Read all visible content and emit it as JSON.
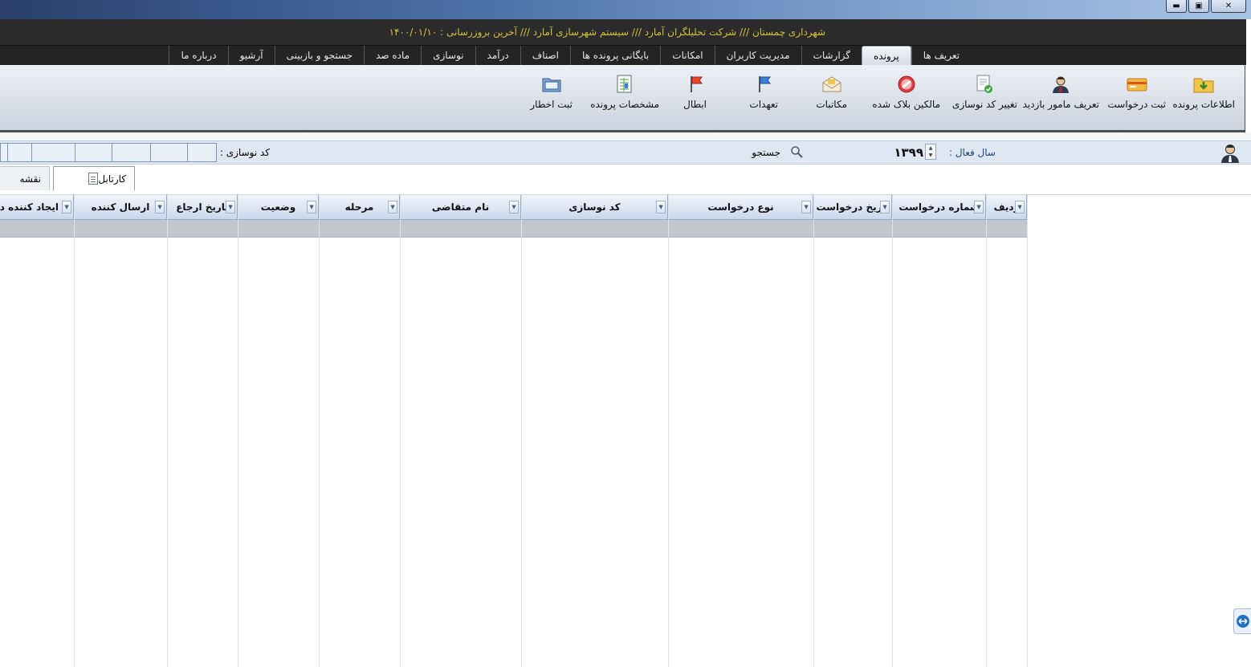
{
  "window": {
    "minimize_glyph": "▬",
    "maximize_glyph": "▣",
    "close_glyph": "✕"
  },
  "info_bar": {
    "text": "شهرداری چمستان  ///  شرکت تحلیلگران آمارد  ///  سیستم شهرسازی آمارد  ///  آخرین بروزرسانی : ۱۴۰۰/۰۱/۱۰"
  },
  "menu_tabs": [
    {
      "label": "تعریف ها",
      "active": false
    },
    {
      "label": "پرونده",
      "active": true
    },
    {
      "label": "گزارشات",
      "active": false
    },
    {
      "label": "مدیریت کاربران",
      "active": false
    },
    {
      "label": "امکانات",
      "active": false
    },
    {
      "label": "بایگانی پرونده ها",
      "active": false
    },
    {
      "label": "اصناف",
      "active": false
    },
    {
      "label": "درآمد",
      "active": false
    },
    {
      "label": "نوسازی",
      "active": false
    },
    {
      "label": "ماده صد",
      "active": false
    },
    {
      "label": "جستجو و بازبینی",
      "active": false
    },
    {
      "label": "آرشیو",
      "active": false
    },
    {
      "label": "درباره ما",
      "active": false
    }
  ],
  "ribbon": {
    "buttons": [
      {
        "label": "اطلاعات پرونده",
        "icon": "folder-download-icon"
      },
      {
        "label": "ثبت درخواست",
        "icon": "card-icon"
      },
      {
        "label": "تعریف مامور بازدید",
        "icon": "inspector-user-icon"
      },
      {
        "label": "تغییر کد نوسازی",
        "icon": "document-check-icon"
      },
      {
        "label": "مالکین بلاک شده",
        "icon": "block-icon"
      },
      {
        "label": "مکاتبات",
        "icon": "envelope-icon"
      },
      {
        "label": "تعهدات",
        "icon": "blue-flag-icon"
      },
      {
        "label": "ابطال",
        "icon": "red-flag-icon"
      },
      {
        "label": "مشخصات پرونده",
        "icon": "spreadsheet-icon"
      },
      {
        "label": "ثبت اخطار",
        "icon": "folder-open-icon"
      }
    ]
  },
  "search_bar": {
    "active_year_label": "سال فعال :",
    "active_year_value": "۱۳۹۹",
    "search_label": "جستجو",
    "renovation_code_label": "کد نوسازی :"
  },
  "doc_tabs": [
    {
      "label": "کارتابل",
      "active": true
    },
    {
      "label": "نقشه",
      "active": false
    }
  ],
  "grid": {
    "columns": [
      "ردیف",
      "شماره درخواست",
      "تاریخ درخواست",
      "نوع درخواست",
      "کد نوسازی",
      "نام متقاضی",
      "مرحله",
      "وضعیت",
      "تاریخ ارجاع",
      "ارسال کننده",
      "ایجاد کننده درخواست"
    ],
    "filter_glyph": "▼"
  },
  "colors": {
    "info_text": "#d6c23a",
    "info_bar_bg": "#2b2b2b",
    "tab_strip_bg": "#242424",
    "grid_header": "#c9d8ec",
    "selected_row": "#c2c7ce"
  }
}
